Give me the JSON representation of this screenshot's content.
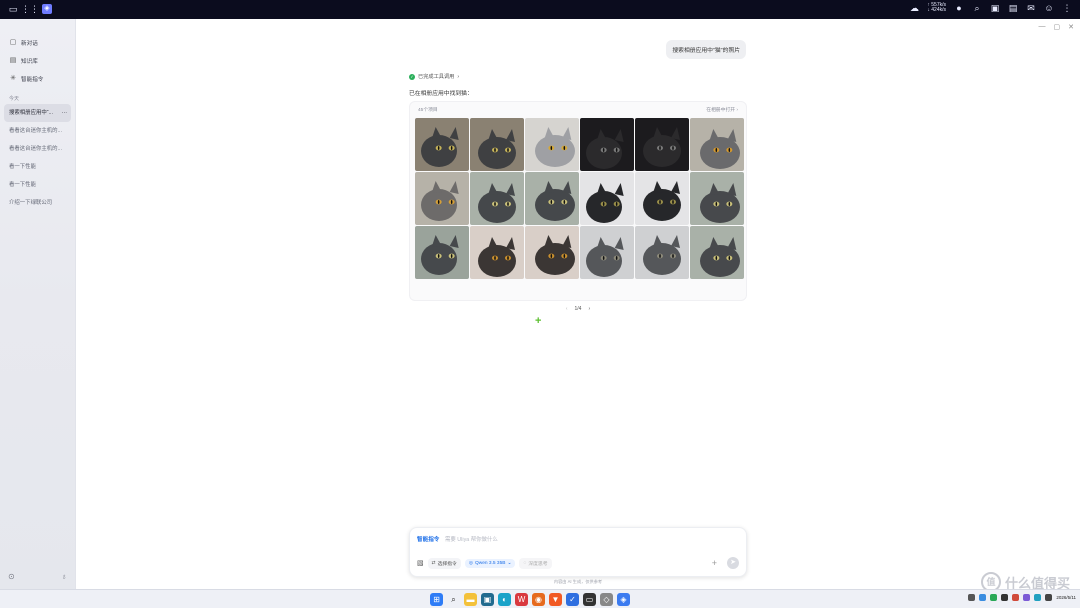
{
  "topbar": {
    "net_up": "↑ 557k/s",
    "net_down": "↓ 424k/s"
  },
  "sidebar": {
    "items": [
      {
        "label": "新对话",
        "icon": "chat-icon"
      },
      {
        "label": "知识库",
        "icon": "book-icon"
      },
      {
        "label": "智能指令",
        "icon": "magic-icon"
      }
    ],
    "section": "今天",
    "history": [
      "搜索相册应用中“...",
      "看看这台迷你主机的...",
      "看看这台迷你主机的...",
      "看一下性能",
      "看一下性能",
      "介绍一下绿联公司"
    ]
  },
  "chat": {
    "user_message": "搜索相册应用中“猫”的照片",
    "tool_status": "已完成工具调用",
    "intro": "已在相册应用中找到猫：",
    "result_count": "45个项目",
    "open_link": "在相册中打开",
    "page": "1/4"
  },
  "composer": {
    "mode": "智能指令",
    "placeholder": "需要 Uliya 帮你做什么",
    "select_cmd": "选择指令",
    "model": "Qwen 3.5 35B",
    "deep_think": "深度思考",
    "disclaimer": "内容由 AI 生成，仅供参考"
  },
  "taskbar": {
    "time": "",
    "date": "2026/5/11"
  },
  "watermark": "什么值得买",
  "colors": {
    "accent": "#1d6fe8",
    "success": "#2aaf5a",
    "plus": "#5bbf2e"
  },
  "photos": [
    {
      "bg": "#8a8172",
      "cat": "#3f4042",
      "eye": "#c4b25a"
    },
    {
      "bg": "#8a8172",
      "cat": "#3f4042",
      "eye": "#c4b25a"
    },
    {
      "bg": "#d6d4d0",
      "cat": "#9fa0a4",
      "eye": "#d5a93a"
    },
    {
      "bg": "#1c1b1e",
      "cat": "#2b2a2c",
      "eye": "#7a7a7a"
    },
    {
      "bg": "#1c1b1e",
      "cat": "#2b2a2c",
      "eye": "#7a7a7a"
    },
    {
      "bg": "#b6b2a8",
      "cat": "#6a6a6c",
      "eye": "#d69a2e"
    },
    {
      "bg": "#b6b2a8",
      "cat": "#6d6b6a",
      "eye": "#d6a038"
    },
    {
      "bg": "#a9b1a8",
      "cat": "#45484b",
      "eye": "#c9c07a"
    },
    {
      "bg": "#a9b1a8",
      "cat": "#45484b",
      "eye": "#c9c07a"
    },
    {
      "bg": "#e4e4e6",
      "cat": "#26272a",
      "eye": "#9a8f4a"
    },
    {
      "bg": "#e4e4e6",
      "cat": "#26272a",
      "eye": "#9a8f4a"
    },
    {
      "bg": "#a9b1a8",
      "cat": "#47494c",
      "eye": "#c9c07a"
    },
    {
      "bg": "#9aa39b",
      "cat": "#46494c",
      "eye": "#c9c07a"
    },
    {
      "bg": "#d9cfc8",
      "cat": "#3b3634",
      "eye": "#c98f2e"
    },
    {
      "bg": "#d9cfc8",
      "cat": "#3b3634",
      "eye": "#c98f2e"
    },
    {
      "bg": "#cfd0d2",
      "cat": "#55575a",
      "eye": "#8d8a7a"
    },
    {
      "bg": "#cfd0d2",
      "cat": "#55575a",
      "eye": "#8d8a7a"
    },
    {
      "bg": "#a9b1a8",
      "cat": "#47494c",
      "eye": "#c9c07a"
    }
  ]
}
